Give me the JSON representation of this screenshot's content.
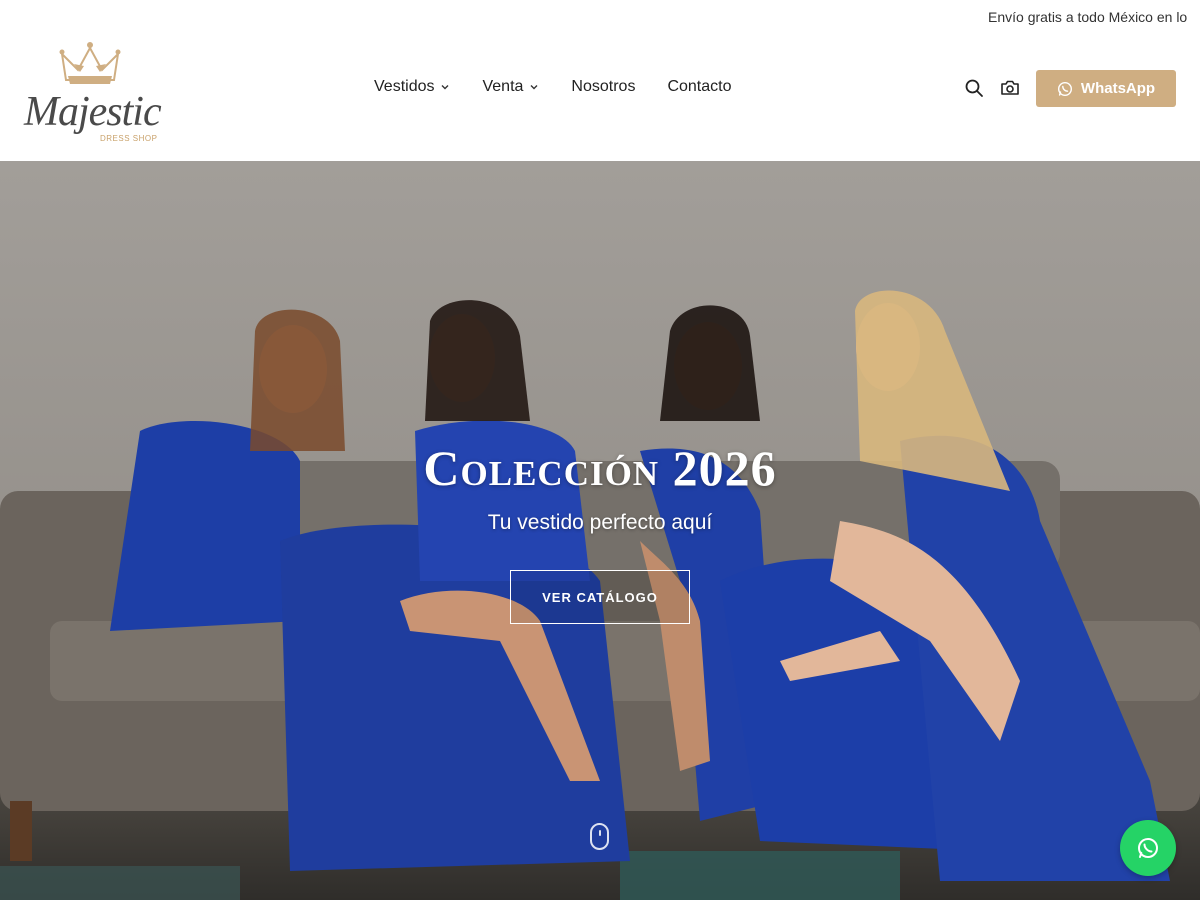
{
  "announcement": {
    "text": "Envío gratis a todo México en lo"
  },
  "brand": {
    "name": "Majestic",
    "tagline": "DRESS SHOP",
    "accent": "#cfae82"
  },
  "nav": {
    "items": [
      {
        "label": "Vestidos",
        "has_dropdown": true
      },
      {
        "label": "Venta",
        "has_dropdown": true
      },
      {
        "label": "Nosotros",
        "has_dropdown": false
      },
      {
        "label": "Contacto",
        "has_dropdown": false
      }
    ]
  },
  "header_icons": [
    "search-icon",
    "camera-icon"
  ],
  "whatsapp_button": {
    "label": "WhatsApp",
    "icon": "whatsapp-icon",
    "color": "#cfae82"
  },
  "hero": {
    "title": "Colección 2026",
    "subtitle": "Tu vestido perfecto aquí",
    "cta_label": "VER CATÁLOGO"
  },
  "floating_whatsapp": {
    "icon": "whatsapp-icon",
    "color": "#25d366"
  }
}
